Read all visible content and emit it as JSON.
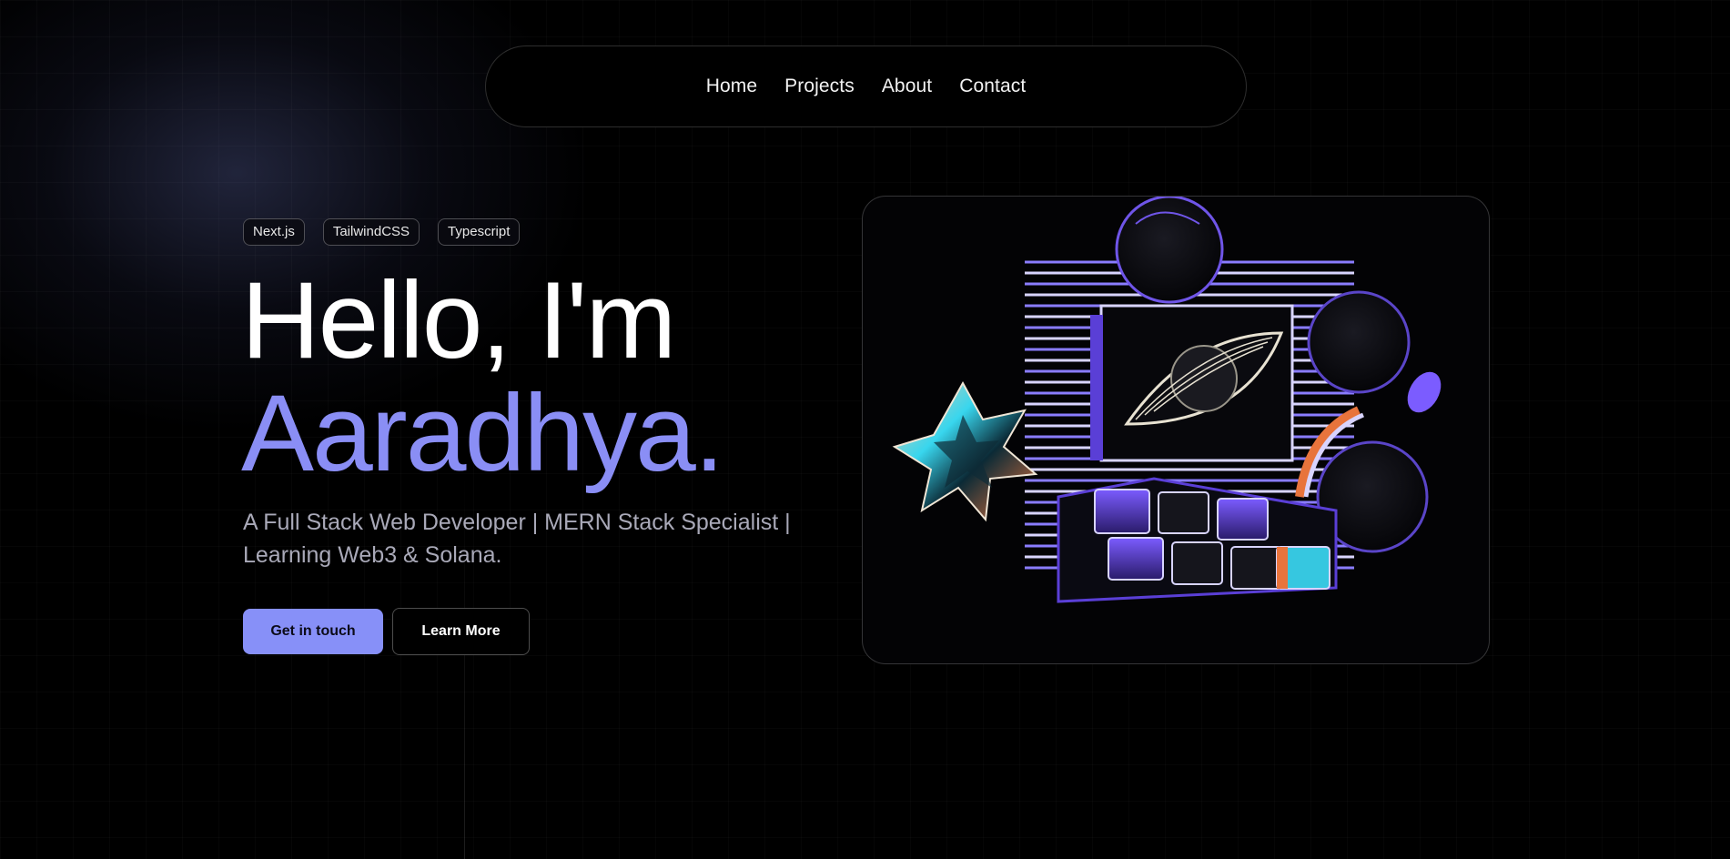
{
  "nav": {
    "items": [
      {
        "label": "Home"
      },
      {
        "label": "Projects"
      },
      {
        "label": "About"
      },
      {
        "label": "Contact"
      }
    ]
  },
  "hero": {
    "tags": [
      "Next.js",
      "TailwindCSS",
      "Typescript"
    ],
    "greeting": "Hello, I'm",
    "name": "Aaradhya.",
    "subtitle": "A Full Stack Web Developer | MERN Stack Specialist | Learning Web3 & Solana.",
    "primary_button": "Get in touch",
    "secondary_button": "Learn More"
  },
  "illustration": {
    "icon": "workspace-illustration",
    "accent": "#7b5cff",
    "highlight": "#36c7e0"
  },
  "colors": {
    "background": "#000000",
    "accent": "#8a8ef5",
    "primary_button": "#8790f8",
    "subtitle": "#a9a9b8"
  }
}
